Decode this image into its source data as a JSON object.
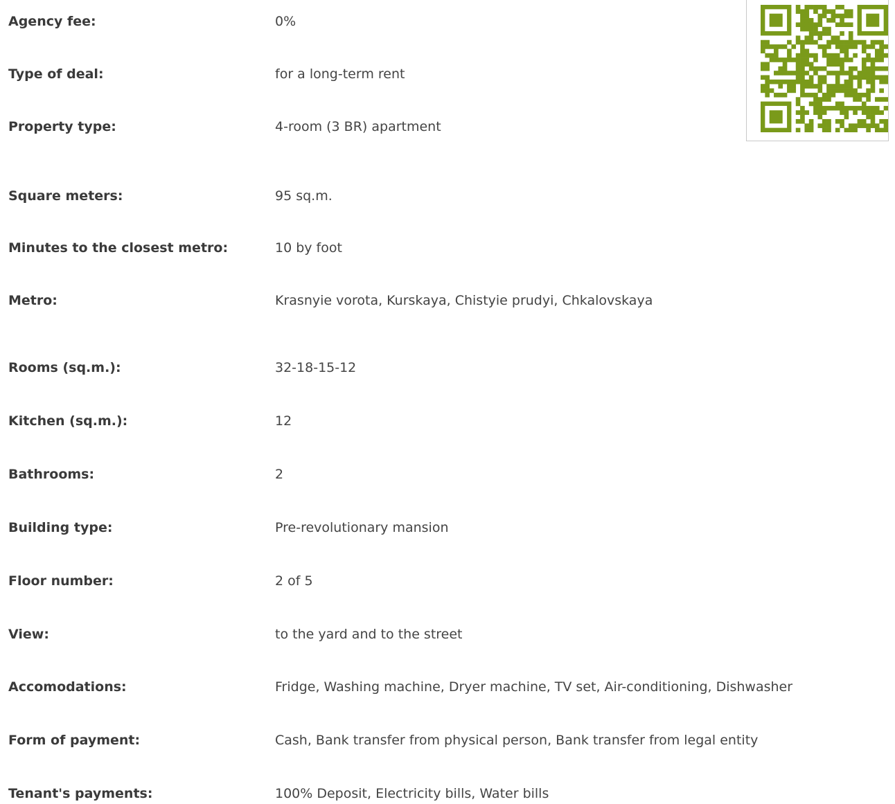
{
  "properties": [
    {
      "label": "Agency fee:",
      "value": "0%"
    },
    {
      "label": "Type of deal:",
      "value": "for a long-term rent"
    },
    {
      "label": "Property type:",
      "value": "4-room (3 BR) apartment"
    },
    {
      "label": "Square meters:",
      "value": "95 sq.m."
    },
    {
      "label": "Minutes to the closest metro:",
      "value": "10 by foot"
    },
    {
      "label": "Metro:",
      "value": "Krasnyie vorota, Kurskaya, Chistyie prudyi, Chkalovskaya"
    },
    {
      "label": "Rooms (sq.m.):",
      "value": "32-18-15-12"
    },
    {
      "label": "Kitchen (sq.m.):",
      "value": "12"
    },
    {
      "label": "Bathrooms:",
      "value": "2"
    },
    {
      "label": "Building type:",
      "value": "Pre-revolutionary mansion"
    },
    {
      "label": "Floor number:",
      "value": "2 of 5"
    },
    {
      "label": "View:",
      "value": "to the yard and to the street"
    },
    {
      "label": "Accomodations:",
      "value": "Fridge, Washing machine, Dryer machine, TV set, Air-conditioning, Dishwasher"
    },
    {
      "label": "Form of payment:",
      "value": "Cash, Bank transfer from physical person, Bank transfer from legal entity"
    },
    {
      "label": "Tenant's payments:",
      "value": "100% Deposit, Electricity bills, Water bills"
    }
  ],
  "qr": {
    "icon": "qr-code-icon",
    "color": "#7a9a1a"
  }
}
